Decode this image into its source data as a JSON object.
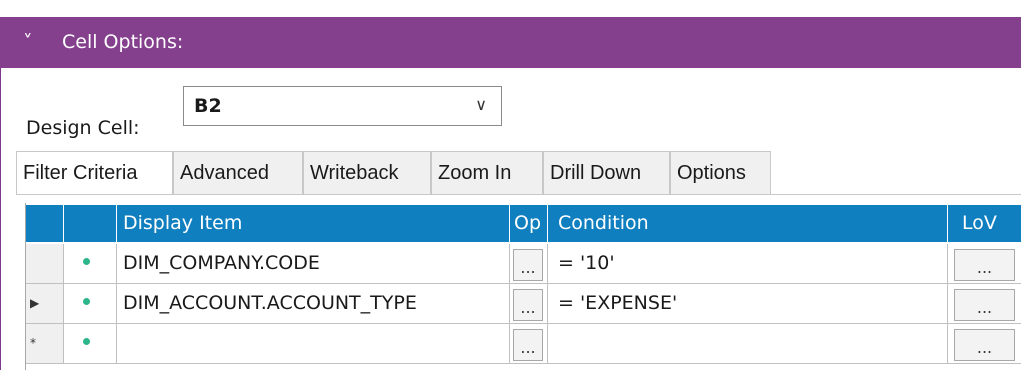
{
  "panel": {
    "title": "Cell Options:",
    "collapse_icon": "chevron-down-icon"
  },
  "design_cell": {
    "label": "Design Cell:",
    "value": "B2"
  },
  "tabs": [
    "Filter Criteria",
    "Advanced",
    "Writeback",
    "Zoom In",
    "Drill Down",
    "Options"
  ],
  "active_tab": "Filter Criteria",
  "grid": {
    "columns": {
      "display_item": "Display Item",
      "op": "Op",
      "condition": "Condition",
      "lov": "LoV"
    },
    "ellipsis": "...",
    "rows": [
      {
        "marker": "",
        "display_item": "DIM_COMPANY.CODE",
        "condition": "= '10'"
      },
      {
        "marker": "▶",
        "display_item": "DIM_ACCOUNT.ACCOUNT_TYPE",
        "condition": "= 'EXPENSE'"
      },
      {
        "marker": "*",
        "display_item": "",
        "condition": ""
      }
    ]
  },
  "colors": {
    "header": "#843f8d",
    "grid_header": "#0f7fbf",
    "status_dot": "#2bb58a"
  }
}
